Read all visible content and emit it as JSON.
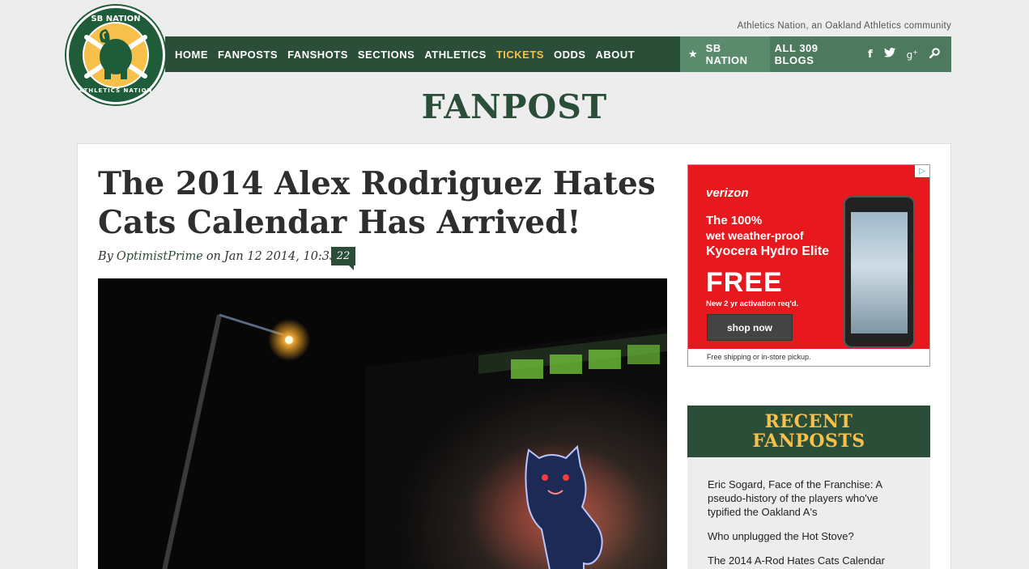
{
  "logo": {
    "top_text": "SB NATION",
    "bottom_text": "ATHLETICS NATION",
    "letter": "A"
  },
  "tagline": "Athletics Nation, an Oakland Athletics community",
  "nav": {
    "items": [
      "HOME",
      "FANPOSTS",
      "FANSHOTS",
      "SECTIONS",
      "ATHLETICS",
      "TICKETS",
      "ODDS",
      "ABOUT"
    ],
    "highlight_item": "TICKETS",
    "sb_nation_label": "SB NATION",
    "all_blogs_label": "ALL 309 BLOGS",
    "social_icons": [
      "facebook-icon",
      "twitter-icon",
      "google-plus-icon",
      "search-icon"
    ]
  },
  "page_heading": "FANPOST",
  "article": {
    "title": "The 2014 Alex Rodriguez Hates Cats Calendar Has Arrived!",
    "by_label": "By",
    "author": "OptimistPrime",
    "on_label": "on",
    "date": "Jan 12 2014, 10:33p",
    "comment_count": "22"
  },
  "ad": {
    "choices_icon": "ad-choices-icon",
    "brand": "verizon",
    "line1": "The 100%",
    "line2": "wet weather-proof",
    "line3": "Kyocera Hydro Elite",
    "free": "FREE",
    "activation": "New 2 yr activation req'd.",
    "button": "shop now",
    "footer": "Free shipping or in-store pickup."
  },
  "sidebar": {
    "recent_title_line1": "RECENT",
    "recent_title_line2": "FANPOSTS",
    "recent_items": [
      "Eric Sogard, Face of the Franchise: A pseudo-history of the players who've typified the Oakland A's",
      "Who unplugged the Hot Stove?",
      "The 2014 A-Rod Hates Cats Calendar"
    ]
  },
  "colors": {
    "brand_green": "#2b4e39",
    "accent_gold": "#f6c04a",
    "ad_red": "#e8191e",
    "background": "#ededed"
  }
}
